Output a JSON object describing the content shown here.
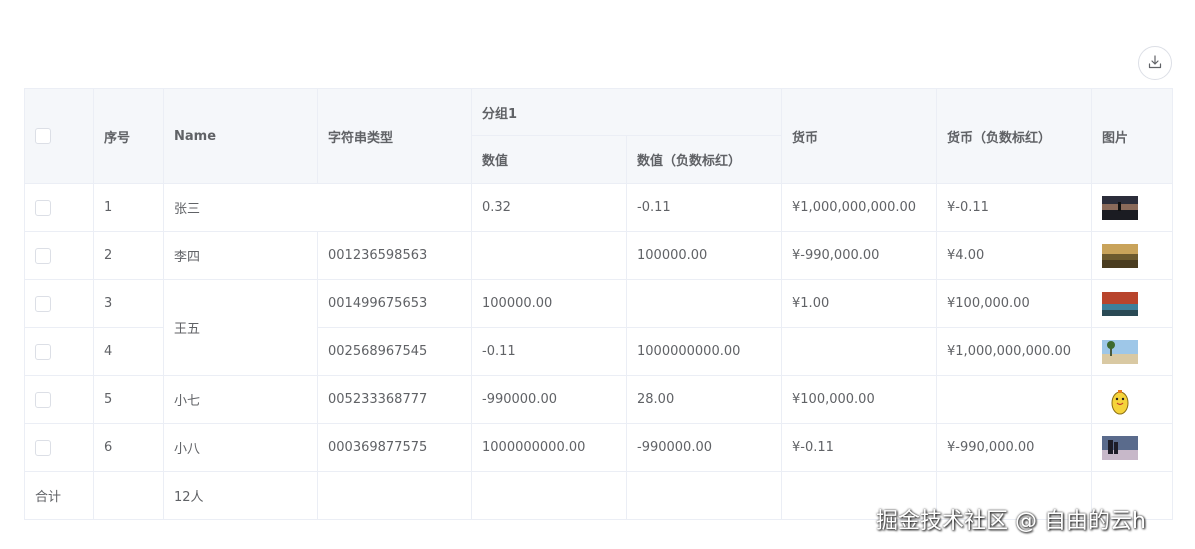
{
  "toolbar": {
    "download_icon": "download-icon"
  },
  "header": {
    "serial": "序号",
    "name": "Name",
    "string_type": "字符串类型",
    "group1": "分组1",
    "value": "数值",
    "value_negative_red": "数值（负数标红）",
    "currency": "货币",
    "currency_negative_red": "货币（负数标红）",
    "image": "图片"
  },
  "rows": [
    {
      "index": "1",
      "name": "张三",
      "code": "",
      "value": "0.32",
      "value_red": "-0.11",
      "currency": "¥1,000,000,000.00",
      "currency_red": "¥-0.11"
    },
    {
      "index": "2",
      "name": "李四",
      "code": "001236598563",
      "value": "",
      "value_red": "100000.00",
      "currency": "¥-990,000.00",
      "currency_red": "¥4.00"
    },
    {
      "index": "3",
      "name": "王五",
      "code": "001499675653",
      "value": "100000.00",
      "value_red": "",
      "currency": "¥1.00",
      "currency_red": "¥100,000.00"
    },
    {
      "index": "4",
      "name": "",
      "code": "002568967545",
      "value": "-0.11",
      "value_red": "1000000000.00",
      "currency": "",
      "currency_red": "¥1,000,000,000.00"
    },
    {
      "index": "5",
      "name": "小七",
      "code": "005233368777",
      "value": "-990000.00",
      "value_red": "28.00",
      "currency": "¥100,000.00",
      "currency_red": ""
    },
    {
      "index": "6",
      "name": "小八",
      "code": "000369877575",
      "value": "1000000000.00",
      "value_red": "-990000.00",
      "currency": "¥-0.11",
      "currency_red": "¥-990,000.00"
    }
  ],
  "footer": {
    "label": "合计",
    "count": "12人"
  },
  "colors": {
    "negative": "#f56c6c",
    "header_bg": "#f5f7fa",
    "border": "#ebeef5"
  },
  "watermark": "掘金技术社区 @ 自由的云h"
}
